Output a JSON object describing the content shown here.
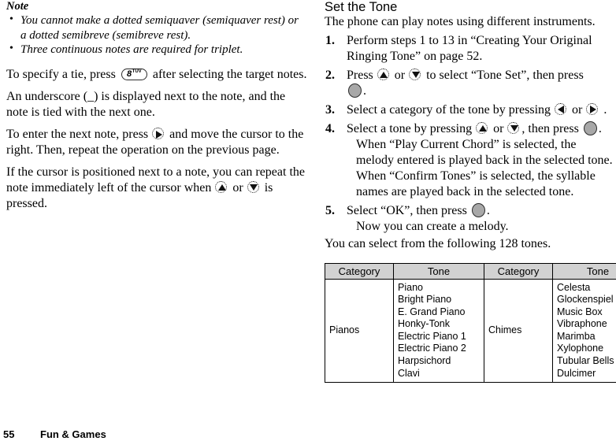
{
  "left_column": {
    "note_heading": "Note",
    "note_bullets": [
      "You cannot make a dotted semiquaver (semiquaver rest) or a dotted semibreve (semibreve rest).",
      "Three continuous notes are required for triplet."
    ],
    "paragraphs": {
      "tie_before": "To specify a tie, press",
      "tie_after": "after selecting the target notes.",
      "underscore": "An underscore (_) is displayed next to the note, and the note is tied with the next one.",
      "next_note_before": "To enter the next note, press",
      "next_note_after": "and move the cursor to the right. Then, repeat the operation on the previous page.",
      "repeat_before": "If the cursor is positioned next to a note, you can repeat the note immediately left of the cursor when",
      "repeat_or": "or",
      "repeat_after": "is pressed."
    },
    "keys": {
      "eight_digit": "8",
      "eight_letters": "TUV",
      "right_key": "right-arrow-key",
      "up_key": "up-arrow-key",
      "down_key": "down-arrow-key"
    }
  },
  "right_column": {
    "section_heading": "Set the Tone",
    "lead": "The phone can play notes using different instruments.",
    "steps": [
      {
        "num": "1.",
        "text": "Perform steps 1 to 13 in “Creating Your Original Ringing Tone” on page 52."
      },
      {
        "num": "2.",
        "before": "Press",
        "or": "or",
        "middle": "to select “Tone Set”, then press",
        "after": "."
      },
      {
        "num": "3.",
        "before": "Select a category of the tone by pressing",
        "or": "or",
        "after": "."
      },
      {
        "num": "4.",
        "before": "Select a tone by pressing",
        "or": "or",
        "middle": ", then press",
        "after": ".",
        "subtext": [
          "When “Play Current Chord” is selected, the melody entered is played back in the selected tone.",
          "When “Confirm Tones” is selected, the syllable names are played back in the selected tone."
        ]
      },
      {
        "num": "5.",
        "before": "Select “OK”, then press",
        "after": ".",
        "subtext": [
          "Now you can create a melody."
        ]
      }
    ],
    "closing_line": "You can select from the following 128 tones."
  },
  "tone_table": {
    "headers": [
      "Category",
      "Tone",
      "Category",
      "Tone"
    ],
    "rows": [
      {
        "category_left": "Pianos",
        "tones_left": [
          "Piano",
          "Bright Piano",
          "E. Grand Piano",
          "Honky-Tonk",
          "Electric Piano 1",
          "Electric Piano 2",
          "Harpsichord",
          "Clavi"
        ],
        "category_right": "Chimes",
        "tones_right": [
          "Celesta",
          "Glockenspiel",
          "Music Box",
          "Vibraphone",
          "Marimba",
          "Xylophone",
          "Tubular Bells",
          "Dulcimer"
        ]
      }
    ],
    "header_bg": "#d2d2d2"
  },
  "footer": {
    "page_number": "55",
    "section": "Fun & Games"
  }
}
